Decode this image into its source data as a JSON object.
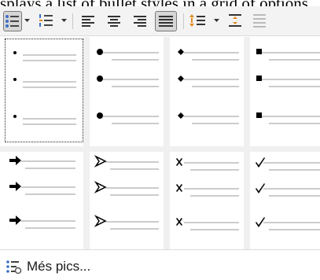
{
  "page_text_fragment": "splays a list of bullet styles in a grid of options.",
  "footer": {
    "more_label": "Més pics..."
  },
  "gallery": {
    "selected_index": 0,
    "rows": [
      [
        "small-dot",
        "large-dot",
        "diamond",
        "square"
      ],
      [
        "arrow",
        "arrowhead",
        "cross",
        "check"
      ]
    ]
  },
  "colors": {
    "toolbar_bg": "#f3f3f3",
    "icon_blue": "#3b6fc9",
    "icon_orange": "#e08a1e",
    "line_gray": "#9a9a9a"
  }
}
